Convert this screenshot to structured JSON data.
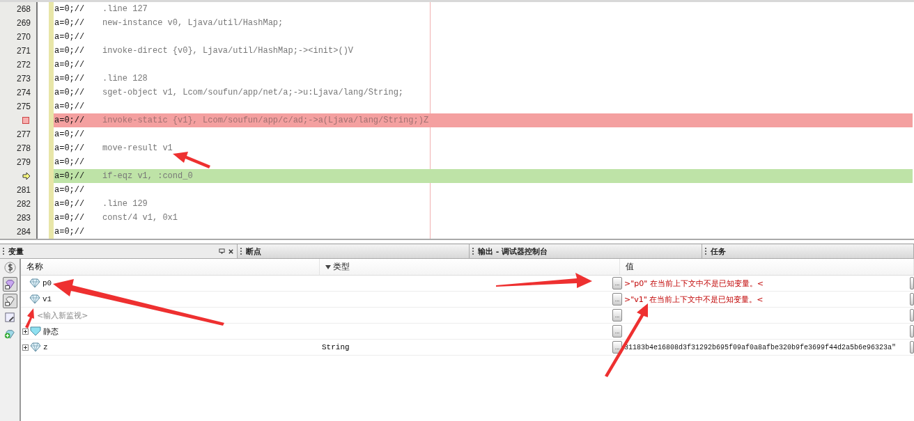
{
  "editor": {
    "lines": [
      {
        "number": "268",
        "kind": "normal",
        "prefix": "a=0;//",
        "code": ".line 127"
      },
      {
        "number": "269",
        "kind": "normal",
        "prefix": "a=0;//",
        "code": "new-instance v0, Ljava/util/HashMap;"
      },
      {
        "number": "270",
        "kind": "normal",
        "prefix": "a=0;//"
      },
      {
        "number": "271",
        "kind": "normal",
        "prefix": "a=0;//",
        "code": "invoke-direct {v0}, Ljava/util/HashMap;-><init>()V"
      },
      {
        "number": "272",
        "kind": "normal",
        "prefix": "a=0;//"
      },
      {
        "number": "273",
        "kind": "normal",
        "prefix": "a=0;//",
        "code": ".line 128"
      },
      {
        "number": "274",
        "kind": "normal",
        "prefix": "a=0;//",
        "code": "sget-object v1, Lcom/soufun/app/net/a;->u:Ljava/lang/String;"
      },
      {
        "number": "275",
        "kind": "normal",
        "prefix": "a=0;//"
      },
      {
        "kind": "breakpoint",
        "prefix": "a=0;//",
        "code": "invoke-static {v1}, Lcom/soufun/app/c/ad;->a(Ljava/lang/String;)Z"
      },
      {
        "number": "277",
        "kind": "normal",
        "prefix": "a=0;//"
      },
      {
        "number": "278",
        "kind": "normal",
        "prefix": "a=0;//",
        "code": "move-result v1"
      },
      {
        "number": "279",
        "kind": "normal",
        "prefix": "a=0;//"
      },
      {
        "kind": "current",
        "prefix": "a=0;//",
        "code": "if-eqz v1, :cond_0"
      },
      {
        "number": "281",
        "kind": "normal",
        "prefix": "a=0;//"
      },
      {
        "number": "282",
        "kind": "normal",
        "prefix": "a=0;//",
        "code": ".line 129"
      },
      {
        "number": "283",
        "kind": "normal",
        "prefix": "a=0;//",
        "code": "const/4 v1, 0x1"
      },
      {
        "number": "284",
        "kind": "normal",
        "prefix": "a=0;//"
      }
    ]
  },
  "panel_tabs": [
    {
      "label": "变量",
      "selected": true
    },
    {
      "label": "断点",
      "selected": false
    },
    {
      "label": "输出 - 调试器控制台",
      "selected": false
    },
    {
      "label": "任务",
      "selected": false
    }
  ],
  "variables": {
    "columns": [
      {
        "label": "名称",
        "sorted": false
      },
      {
        "label": "类型",
        "sorted": true
      },
      {
        "label": "值",
        "sorted": false
      }
    ],
    "rows": [
      {
        "kind": "variable",
        "name": "p0",
        "value": ">\"p0\" 在当前上下文中不是已知变量。<",
        "error": true,
        "button": "..."
      },
      {
        "kind": "variable",
        "name": "v1",
        "value": ">\"v1\" 在当前上下文中不是已知变量。<",
        "error": true,
        "button": "..."
      },
      {
        "kind": "new-watch",
        "name": "<输入新监视>",
        "error": false,
        "button": "..."
      },
      {
        "kind": "static",
        "name": "静态",
        "error": false,
        "expanded": false,
        "button": "..."
      },
      {
        "kind": "field",
        "name": "z",
        "type": "String",
        "value": "31183b4e16808d3f31292b695f09af0a8afbe320b9fe3699f44d2a5b6e96323a\"",
        "error": false,
        "expanded": false,
        "button": "..."
      }
    ]
  }
}
